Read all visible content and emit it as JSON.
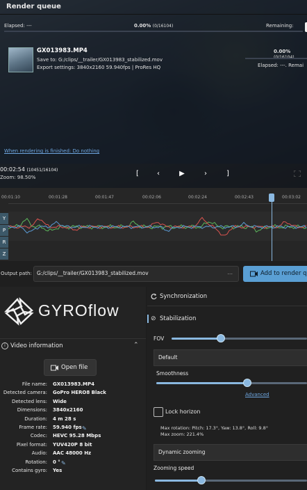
{
  "render_queue": {
    "title": "Render queue",
    "elapsed_label": "Elapsed: ---",
    "progress_text": "0.00%",
    "progress_frames": "(0/16104)",
    "remaining_label": "Remaining:",
    "job": {
      "filename": "GX013983.MP4",
      "save_to": "Save to: G:/clips/__trailer/GX013983_stabilized.mov",
      "export_settings": "Export settings: 3840x2160 59.940fps | ProRes HQ",
      "percent": "0.00%",
      "frames": "(0/16104)",
      "elapsed_remaining": "Elapsed: ---. Remai"
    },
    "when_finished": "When rendering is finished: Do nothing"
  },
  "player": {
    "timecode": "00:02:54",
    "frame": "(10451/16104)",
    "zoom": "Zoom: 98.50%",
    "controls": [
      "[",
      "‹",
      "▶",
      "›",
      "]"
    ]
  },
  "timeline": {
    "ticks": [
      "00:01:10",
      "00:01:28",
      "00:01:47",
      "00:02:06",
      "00:02:24",
      "00:02:43",
      "00:03:02"
    ],
    "axes": [
      "Y",
      "P",
      "R",
      "Z"
    ],
    "playhead_fraction": 0.882
  },
  "output": {
    "label": "Output path:",
    "path": "G:/clips/__trailer/GX013983_stabilized.mov",
    "more": "...",
    "add_button": "Add to render q"
  },
  "logo": {
    "text": "GYROflow"
  },
  "video_info": {
    "header": "Video information",
    "open_file": "Open file",
    "rows": [
      {
        "label": "File name:",
        "value": "GX013983.MP4"
      },
      {
        "label": "Detected camera:",
        "value": "GoPro HERO8 Black"
      },
      {
        "label": "Detected lens:",
        "value": "Wide"
      },
      {
        "label": "Dimensions:",
        "value": "3840x2160"
      },
      {
        "label": "Duration:",
        "value": "4 m 28 s"
      },
      {
        "label": "Frame rate:",
        "value": "59.940 fps"
      },
      {
        "label": "Codec:",
        "value": "HEVC 95.28 Mbps"
      },
      {
        "label": "Pixel format:",
        "value": "YUV420P 8 bit"
      },
      {
        "label": "Audio:",
        "value": "AAC 48000 Hz"
      },
      {
        "label": "Rotation:",
        "value": "0 °"
      },
      {
        "label": "Contains gyro:",
        "value": "Yes"
      }
    ]
  },
  "sync": {
    "label": "Synchronization"
  },
  "stabilization": {
    "label": "Stabilization",
    "fov_label": "FOV",
    "fov_value": 0.36,
    "method": "Default",
    "smoothness_label": "Smoothness",
    "smoothness_value": 0.6,
    "advanced": "Advanced",
    "lock_horizon": "Lock horizon",
    "max_rotation": "Max rotation: Pitch: 17.3°, Yaw: 13.8°, Roll: 9.8°",
    "max_zoom": "Max zoom: 221.4%",
    "dynamic_zooming": "Dynamic zooming",
    "zooming_speed_label": "Zooming speed",
    "zooming_speed_value": 0.3
  },
  "colors": {
    "accent": "#8ab8e0",
    "button": "#5a9fd4"
  }
}
